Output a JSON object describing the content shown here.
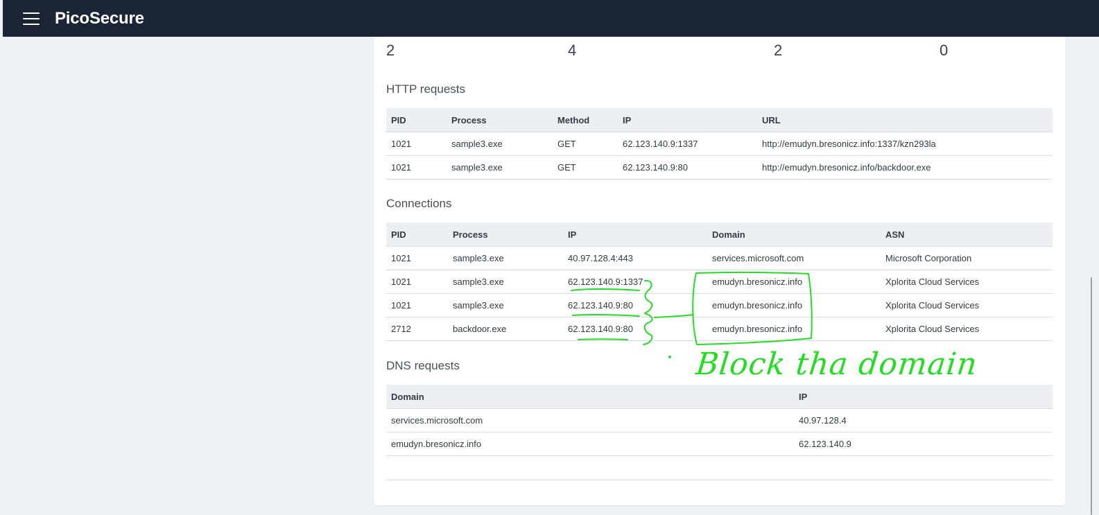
{
  "app": {
    "name": "PicoSecure",
    "menu_icon": "hamburger-menu-icon"
  },
  "stats": [
    "2",
    "4",
    "2",
    "0"
  ],
  "http": {
    "title": "HTTP requests",
    "columns": [
      "PID",
      "Process",
      "Method",
      "IP",
      "URL"
    ],
    "rows": [
      [
        "1021",
        "sample3.exe",
        "GET",
        "62.123.140.9:1337",
        "http://emudyn.bresonicz.info:1337/kzn293la"
      ],
      [
        "1021",
        "sample3.exe",
        "GET",
        "62.123.140.9:80",
        "http://emudyn.bresonicz.info/backdoor.exe"
      ]
    ]
  },
  "connections": {
    "title": "Connections",
    "columns": [
      "PID",
      "Process",
      "IP",
      "Domain",
      "ASN"
    ],
    "rows": [
      [
        "1021",
        "sample3.exe",
        "40.97.128.4:443",
        "services.microsoft.com",
        "Microsoft Corporation"
      ],
      [
        "1021",
        "sample3.exe",
        "62.123.140.9:1337",
        "emudyn.bresonicz.info",
        "Xplorita Cloud Services"
      ],
      [
        "1021",
        "sample3.exe",
        "62.123.140.9:80",
        "emudyn.bresonicz.info",
        "Xplorita Cloud Services"
      ],
      [
        "2712",
        "backdoor.exe",
        "62.123.140.9:80",
        "emudyn.bresonicz.info",
        "Xplorita Cloud Services"
      ]
    ]
  },
  "dns": {
    "title": "DNS requests",
    "columns": [
      "Domain",
      "IP"
    ],
    "rows": [
      [
        "services.microsoft.com",
        "40.97.128.4"
      ],
      [
        "emudyn.bresonicz.info",
        "62.123.140.9"
      ]
    ]
  },
  "annotation": {
    "text": "Block tha domain",
    "color": "#22dd22"
  }
}
